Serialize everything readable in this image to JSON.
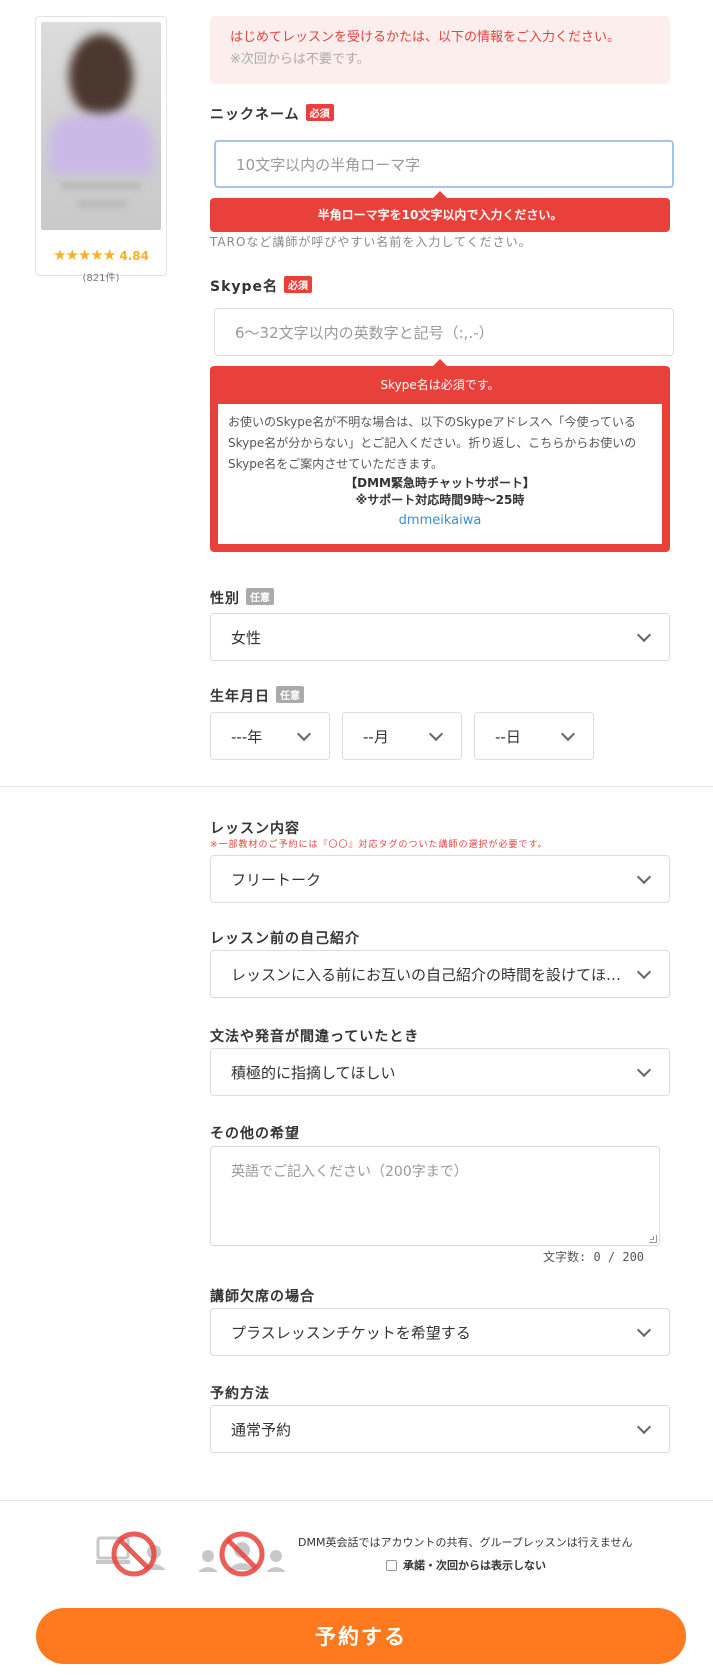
{
  "teacher": {
    "rating": "4.84",
    "review_count": "(821件)",
    "stars": "★★★★★"
  },
  "notice": {
    "line1": "はじめてレッスンを受けるかたは、以下の情報をご入力ください。",
    "line2": "※次回からは不要です。"
  },
  "nickname": {
    "label": "ニックネーム",
    "badge": "必須",
    "placeholder": "10文字以内の半角ローマ字",
    "error": "半角ローマ字を10文字以内で入力ください。",
    "hint": "TAROなど講師が呼びやすい名前を入力してください。"
  },
  "skype": {
    "label": "Skype名",
    "badge": "必須",
    "placeholder": "6～32文字以内の英数字と記号（:,.-）",
    "error_title": "Skype名は必須です。",
    "help_text": "お使いのSkype名が不明な場合は、以下のSkypeアドレスへ「今使っているSkype名が分からない」とご記入ください。折り返し、こちらからお使いのSkype名をご案内させていただきます。",
    "support_line1": "【DMM緊急時チャットサポート】",
    "support_line2": "※サポート対応時間9時～25時",
    "support_link": "dmmeikaiwa"
  },
  "gender": {
    "label": "性別",
    "badge": "任意",
    "value": "女性"
  },
  "birthday": {
    "label": "生年月日",
    "badge": "任意",
    "year": "---年",
    "month": "--月",
    "day": "--日"
  },
  "lesson_content": {
    "label": "レッスン内容",
    "note": "※一部教材のご予約には『〇〇』対応タグのついた講師の選択が必要です。",
    "value": "フリートーク"
  },
  "self_intro": {
    "label": "レッスン前の自己紹介",
    "value": "レッスンに入る前にお互いの自己紹介の時間を設けてほしい"
  },
  "correction": {
    "label": "文法や発音が間違っていたとき",
    "value": "積極的に指摘してほしい"
  },
  "other_requests": {
    "label": "その他の希望",
    "placeholder": "英語でご記入ください（200字まで）",
    "char_count": "文字数: 0 / 200"
  },
  "teacher_absence": {
    "label": "講師欠席の場合",
    "value": "プラスレッスンチケットを希望する"
  },
  "booking_method": {
    "label": "予約方法",
    "value": "通常予約"
  },
  "policy": {
    "text": "DMM英会話ではアカウントの共有、グループレッスンは行えません",
    "checkbox_label": "承諾・次回からは表示しない"
  },
  "submit_label": "予約する",
  "colors": {
    "accent": "#ff7a1f",
    "error": "#e8413c",
    "star": "#f5b323",
    "link": "#3a8fd6"
  }
}
